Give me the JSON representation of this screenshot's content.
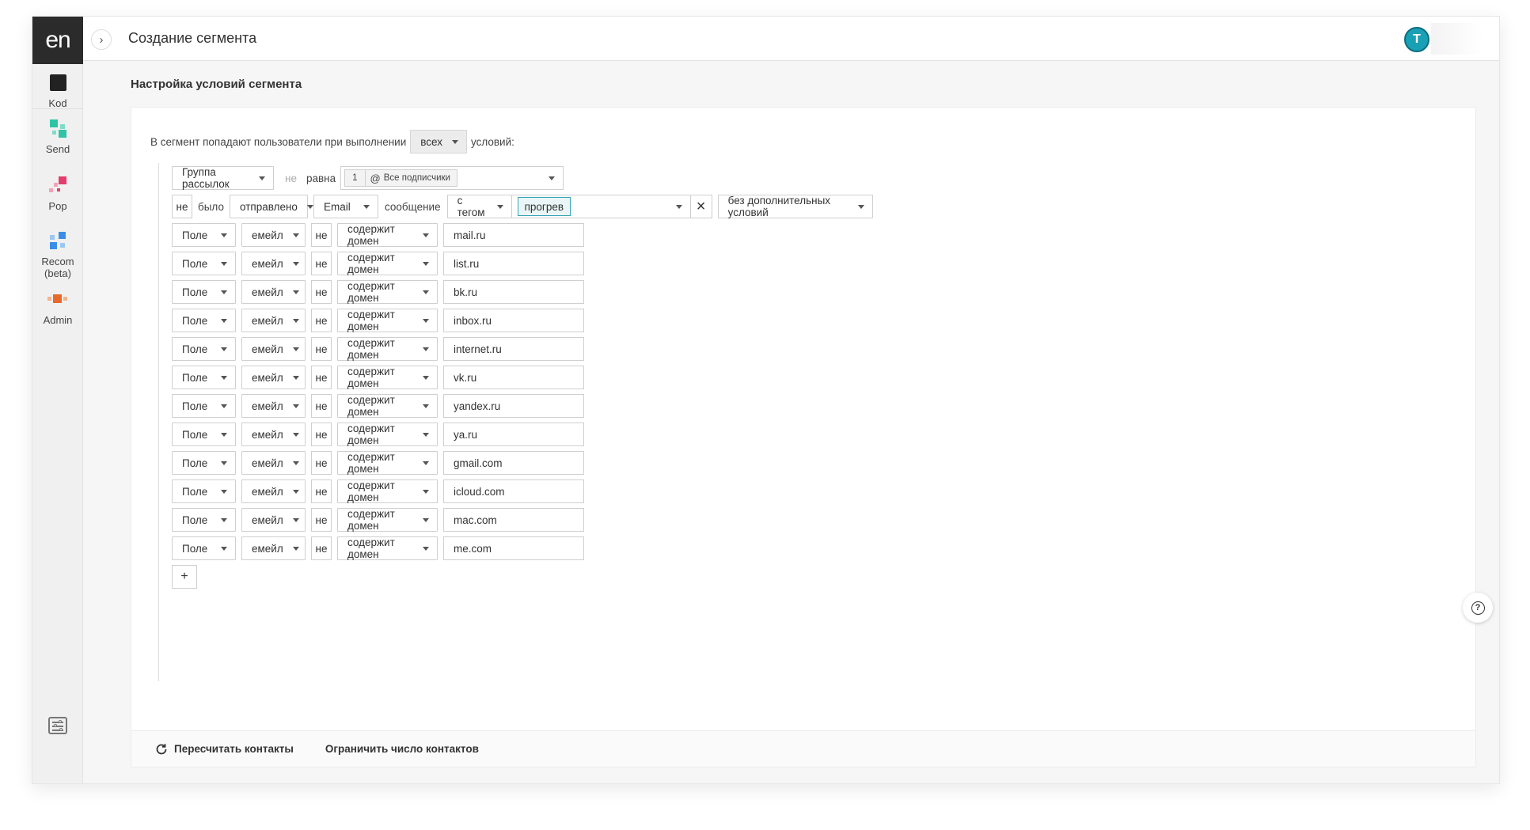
{
  "sidebar": {
    "logo": "en",
    "items": [
      {
        "label": "Kod",
        "icon": "kod-icon"
      },
      {
        "label": "Send",
        "icon": "send-icon"
      },
      {
        "label": "Pop",
        "icon": "pop-icon"
      },
      {
        "label": "Recom (beta)",
        "icon": "recom-icon"
      },
      {
        "label": "Admin",
        "icon": "admin-icon"
      }
    ],
    "settings_icon": "settings-sliders-icon"
  },
  "header": {
    "title": "Создание сегмента",
    "avatar_letter": "T",
    "avatar_color": "#1aa0b5"
  },
  "section_title": "Настройка условий сегмента",
  "intro": {
    "prefix": "В сегмент попадают пользователи при выполнении",
    "mode": "всех",
    "suffix": "условий:"
  },
  "group_condition": {
    "type": "Группа рассылок",
    "negate": "не",
    "operator": "равна",
    "group_id": "1",
    "group_name": "Все подписчики"
  },
  "message_condition": {
    "negate": "не",
    "was": "было",
    "action": "отправлено",
    "channel": "Email",
    "message_label": "сообщение",
    "tag_mode": "с тегом",
    "tag": "прогрев",
    "extra": "без дополнительных условий"
  },
  "field_conditions": [
    {
      "type": "Поле",
      "field": "емейл",
      "negate": "не",
      "operator": "содержит домен",
      "value": "mail.ru"
    },
    {
      "type": "Поле",
      "field": "емейл",
      "negate": "не",
      "operator": "содержит домен",
      "value": "list.ru"
    },
    {
      "type": "Поле",
      "field": "емейл",
      "negate": "не",
      "operator": "содержит домен",
      "value": "bk.ru"
    },
    {
      "type": "Поле",
      "field": "емейл",
      "negate": "не",
      "operator": "содержит домен",
      "value": "inbox.ru"
    },
    {
      "type": "Поле",
      "field": "емейл",
      "negate": "не",
      "operator": "содержит домен",
      "value": "internet.ru"
    },
    {
      "type": "Поле",
      "field": "емейл",
      "negate": "не",
      "operator": "содержит домен",
      "value": "vk.ru"
    },
    {
      "type": "Поле",
      "field": "емейл",
      "negate": "не",
      "operator": "содержит домен",
      "value": "yandex.ru"
    },
    {
      "type": "Поле",
      "field": "емейл",
      "negate": "не",
      "operator": "содержит домен",
      "value": "ya.ru"
    },
    {
      "type": "Поле",
      "field": "емейл",
      "negate": "не",
      "operator": "содержит домен",
      "value": "gmail.com"
    },
    {
      "type": "Поле",
      "field": "емейл",
      "negate": "не",
      "operator": "содержит домен",
      "value": "icloud.com"
    },
    {
      "type": "Поле",
      "field": "емейл",
      "negate": "не",
      "operator": "содержит домен",
      "value": "mac.com"
    },
    {
      "type": "Поле",
      "field": "емейл",
      "negate": "не",
      "operator": "содержит домен",
      "value": "me.com"
    }
  ],
  "add_button": "+",
  "footer": {
    "recalc": "Пересчитать контакты",
    "limit": "Ограничить число контактов"
  }
}
